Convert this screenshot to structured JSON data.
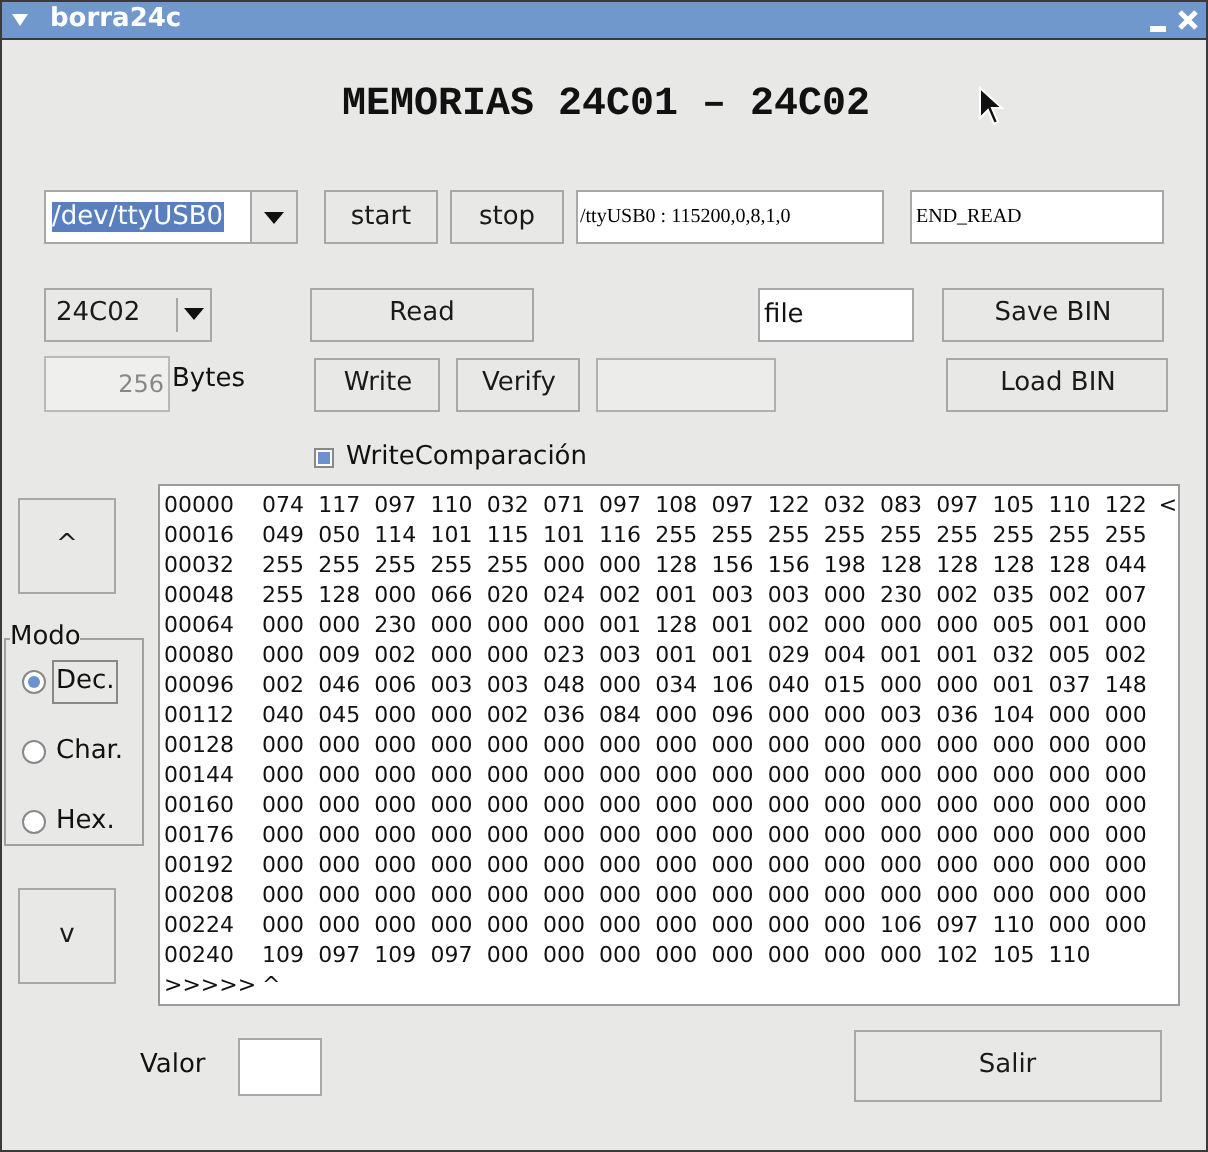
{
  "window": {
    "title": "borra24c"
  },
  "heading": "MEMORIAS 24C01 – 24C02",
  "port": {
    "value": "/dev/ttyUSB0"
  },
  "start_button": "start",
  "stop_button": "stop",
  "port_settings": "/ttyUSB0 : 115200,0,8,1,0",
  "status": "END_READ",
  "chip": {
    "value": "24C02"
  },
  "read_button": "Read",
  "file_field": {
    "value": "file"
  },
  "save_button": "Save BIN",
  "size": {
    "value": "256",
    "disabled": true
  },
  "size_unit": "Bytes",
  "write_button": "Write",
  "verify_button": "Verify",
  "load_button": "Load BIN",
  "compare_checkbox": {
    "label": "WriteComparación",
    "checked": true
  },
  "scroll_up_button": "^",
  "mode": {
    "title": "Modo",
    "options": [
      {
        "label": "Dec.",
        "selected": true
      },
      {
        "label": "Char.",
        "selected": false
      },
      {
        "label": "Hex.",
        "selected": false
      }
    ]
  },
  "scroll_down_button": "v",
  "dump": {
    "rows": [
      {
        "address": "00000",
        "values": "074 117 097 110 032 071 097 108 097 122 032 083 097 105 110 122",
        "marker": "<"
      },
      {
        "address": "00016",
        "values": "049 050 114 101 115 101 116 255 255 255 255 255 255 255 255 255"
      },
      {
        "address": "00032",
        "values": "255 255 255 255 255 000 000 128 156 156 198 128 128 128 128 044"
      },
      {
        "address": "00048",
        "values": "255 128 000 066 020 024 002 001 003 003 000 230 002 035 002 007"
      },
      {
        "address": "00064",
        "values": "000 000 230 000 000 000 001 128 001 002 000 000 000 005 001 000"
      },
      {
        "address": "00080",
        "values": "000 009 002 000 000 023 003 001 001 029 004 001 001 032 005 002"
      },
      {
        "address": "00096",
        "values": "002 046 006 003 003 048 000 034 106 040 015 000 000 001 037 148"
      },
      {
        "address": "00112",
        "values": "040 045 000 000 002 036 084 000 096 000 000 003 036 104 000 000"
      },
      {
        "address": "00128",
        "values": "000 000 000 000 000 000 000 000 000 000 000 000 000 000 000 000"
      },
      {
        "address": "00144",
        "values": "000 000 000 000 000 000 000 000 000 000 000 000 000 000 000 000"
      },
      {
        "address": "00160",
        "values": "000 000 000 000 000 000 000 000 000 000 000 000 000 000 000 000"
      },
      {
        "address": "00176",
        "values": "000 000 000 000 000 000 000 000 000 000 000 000 000 000 000 000"
      },
      {
        "address": "00192",
        "values": "000 000 000 000 000 000 000 000 000 000 000 000 000 000 000 000"
      },
      {
        "address": "00208",
        "values": "000 000 000 000 000 000 000 000 000 000 000 000 000 000 000 000"
      },
      {
        "address": "00224",
        "values": "000 000 000 000 000 000 000 000 000 000 000 106 097 110 000 000"
      },
      {
        "address": "00240",
        "values": "109 097 109 097 000 000 000 000 000 000 000 000 102 105 110"
      }
    ],
    "prompt": {
      "address": ">>>>>",
      "values": "^"
    }
  },
  "value_label": "Valor",
  "exit_button": "Salir"
}
